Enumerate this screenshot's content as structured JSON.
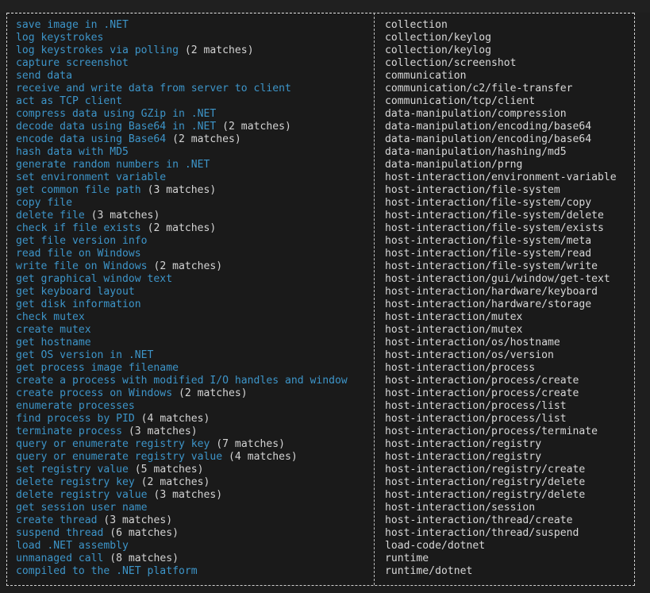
{
  "colors": {
    "background": "#1a1a1a",
    "capability_text": "#3d95c9",
    "namespace_text": "#d8d8d8",
    "border": "#cfcfcf"
  },
  "rows": [
    {
      "capability": "save image in .NET",
      "count": "",
      "namespace": "collection"
    },
    {
      "capability": "log keystrokes",
      "count": "",
      "namespace": "collection/keylog"
    },
    {
      "capability": "log keystrokes via polling",
      "count": "(2 matches)",
      "namespace": "collection/keylog"
    },
    {
      "capability": "capture screenshot",
      "count": "",
      "namespace": "collection/screenshot"
    },
    {
      "capability": "send data",
      "count": "",
      "namespace": "communication"
    },
    {
      "capability": "receive and write data from server to client",
      "count": "",
      "namespace": "communication/c2/file-transfer"
    },
    {
      "capability": "act as TCP client",
      "count": "",
      "namespace": "communication/tcp/client"
    },
    {
      "capability": "compress data using GZip in .NET",
      "count": "",
      "namespace": "data-manipulation/compression"
    },
    {
      "capability": "decode data using Base64 in .NET",
      "count": "(2 matches)",
      "namespace": "data-manipulation/encoding/base64"
    },
    {
      "capability": "encode data using Base64",
      "count": "(2 matches)",
      "namespace": "data-manipulation/encoding/base64"
    },
    {
      "capability": "hash data with MD5",
      "count": "",
      "namespace": "data-manipulation/hashing/md5"
    },
    {
      "capability": "generate random numbers in .NET",
      "count": "",
      "namespace": "data-manipulation/prng"
    },
    {
      "capability": "set environment variable",
      "count": "",
      "namespace": "host-interaction/environment-variable"
    },
    {
      "capability": "get common file path",
      "count": "(3 matches)",
      "namespace": "host-interaction/file-system"
    },
    {
      "capability": "copy file",
      "count": "",
      "namespace": "host-interaction/file-system/copy"
    },
    {
      "capability": "delete file",
      "count": "(3 matches)",
      "namespace": "host-interaction/file-system/delete"
    },
    {
      "capability": "check if file exists",
      "count": "(2 matches)",
      "namespace": "host-interaction/file-system/exists"
    },
    {
      "capability": "get file version info",
      "count": "",
      "namespace": "host-interaction/file-system/meta"
    },
    {
      "capability": "read file on Windows",
      "count": "",
      "namespace": "host-interaction/file-system/read"
    },
    {
      "capability": "write file on Windows",
      "count": "(2 matches)",
      "namespace": "host-interaction/file-system/write"
    },
    {
      "capability": "get graphical window text",
      "count": "",
      "namespace": "host-interaction/gui/window/get-text"
    },
    {
      "capability": "get keyboard layout",
      "count": "",
      "namespace": "host-interaction/hardware/keyboard"
    },
    {
      "capability": "get disk information",
      "count": "",
      "namespace": "host-interaction/hardware/storage"
    },
    {
      "capability": "check mutex",
      "count": "",
      "namespace": "host-interaction/mutex"
    },
    {
      "capability": "create mutex",
      "count": "",
      "namespace": "host-interaction/mutex"
    },
    {
      "capability": "get hostname",
      "count": "",
      "namespace": "host-interaction/os/hostname"
    },
    {
      "capability": "get OS version in .NET",
      "count": "",
      "namespace": "host-interaction/os/version"
    },
    {
      "capability": "get process image filename",
      "count": "",
      "namespace": "host-interaction/process"
    },
    {
      "capability": "create a process with modified I/O handles and window",
      "count": "",
      "namespace": "host-interaction/process/create"
    },
    {
      "capability": "create process on Windows",
      "count": "(2 matches)",
      "namespace": "host-interaction/process/create"
    },
    {
      "capability": "enumerate processes",
      "count": "",
      "namespace": "host-interaction/process/list"
    },
    {
      "capability": "find process by PID",
      "count": "(4 matches)",
      "namespace": "host-interaction/process/list"
    },
    {
      "capability": "terminate process",
      "count": "(3 matches)",
      "namespace": "host-interaction/process/terminate"
    },
    {
      "capability": "query or enumerate registry key",
      "count": "(7 matches)",
      "namespace": "host-interaction/registry"
    },
    {
      "capability": "query or enumerate registry value",
      "count": "(4 matches)",
      "namespace": "host-interaction/registry"
    },
    {
      "capability": "set registry value",
      "count": "(5 matches)",
      "namespace": "host-interaction/registry/create"
    },
    {
      "capability": "delete registry key",
      "count": "(2 matches)",
      "namespace": "host-interaction/registry/delete"
    },
    {
      "capability": "delete registry value",
      "count": "(3 matches)",
      "namespace": "host-interaction/registry/delete"
    },
    {
      "capability": "get session user name",
      "count": "",
      "namespace": "host-interaction/session"
    },
    {
      "capability": "create thread",
      "count": "(3 matches)",
      "namespace": "host-interaction/thread/create"
    },
    {
      "capability": "suspend thread",
      "count": "(6 matches)",
      "namespace": "host-interaction/thread/suspend"
    },
    {
      "capability": "load .NET assembly",
      "count": "",
      "namespace": "load-code/dotnet"
    },
    {
      "capability": "unmanaged call",
      "count": "(8 matches)",
      "namespace": "runtime"
    },
    {
      "capability": "compiled to the .NET platform",
      "count": "",
      "namespace": "runtime/dotnet"
    }
  ]
}
